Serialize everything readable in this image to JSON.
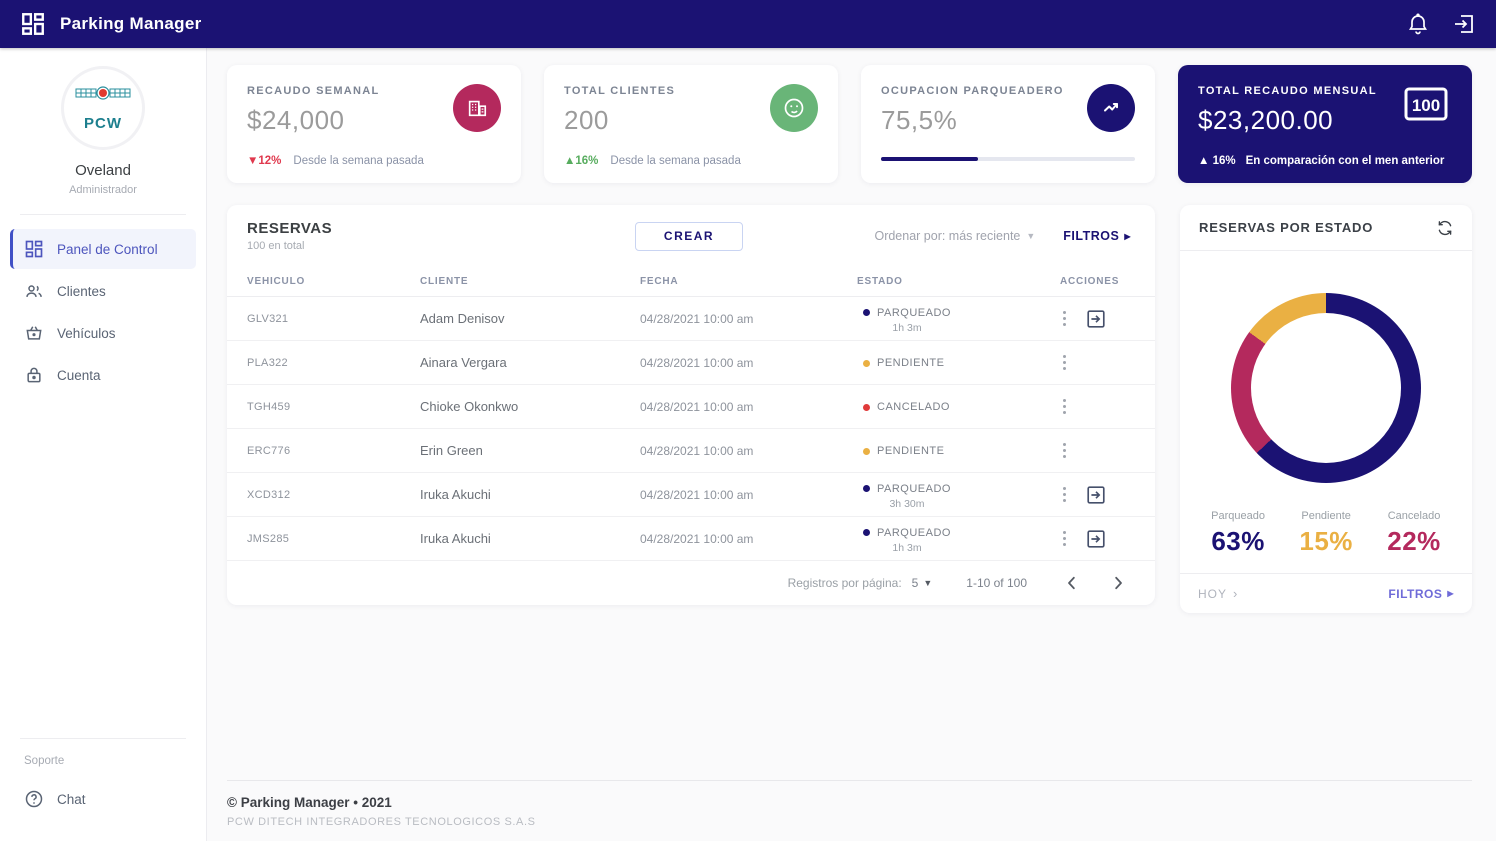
{
  "colors": {
    "primary_navy": "#1b1273",
    "accent_crimson": "#b4295d",
    "accent_amber": "#eab043",
    "accent_green": "#69b578",
    "negative_red": "#e0394e",
    "positive_green": "#57ac5e",
    "filters_purple": "#6f6bd8"
  },
  "topbar": {
    "title": "Parking Manager"
  },
  "sidebar": {
    "logo_text": "PCW",
    "user_name": "Oveland",
    "user_role": "Administrador",
    "items": [
      {
        "label": "Panel de Control",
        "icon": "dashboard-icon",
        "active": true
      },
      {
        "label": "Clientes",
        "icon": "people-icon",
        "active": false
      },
      {
        "label": "Vehículos",
        "icon": "basket-icon",
        "active": false
      },
      {
        "label": "Cuenta",
        "icon": "lock-icon",
        "active": false
      }
    ],
    "support_section_label": "Soporte",
    "chat_item": {
      "label": "Chat",
      "icon": "help-icon"
    }
  },
  "stats": [
    {
      "label": "RECAUDO SEMANAL",
      "value": "$24,000",
      "delta": "12%",
      "delta_dir": "down",
      "note": "Desde la semana pasada",
      "icon": "building-icon",
      "icon_bg": "#b4295d"
    },
    {
      "label": "TOTAL CLIENTES",
      "value": "200",
      "delta": "16%",
      "delta_dir": "up",
      "note": "Desde la semana pasada",
      "icon": "clients-icon",
      "icon_bg": "#69b578"
    },
    {
      "label": "OCUPACION PARQUEADERO",
      "value": "75,5%",
      "icon": "trend-icon",
      "icon_bg": "#1b1273",
      "progress_fill_pct": 38
    },
    {
      "label": "TOTAL RECAUDO MENSUAL",
      "value": "$23,200.00",
      "delta": "16%",
      "delta_dir": "up",
      "note": "En comparación con el men anterior",
      "icon": "banknote-100-icon",
      "dark": true
    }
  ],
  "reservations": {
    "title": "RESERVAS",
    "subtitle": "100 en total",
    "create_label": "CREAR",
    "sort_label": "Ordenar por: más reciente",
    "filters_label": "FILTROS",
    "columns": [
      "VEHICULO",
      "CLIENTE",
      "FECHA",
      "ESTADO",
      "ACCIONES"
    ],
    "rows": [
      {
        "vehicle": "GLV321",
        "client": "Adam Denisov",
        "date": "04/28/2021 10:00 am",
        "status": "PARQUEADO",
        "duration": "1h 3m",
        "status_color": "#1b1273",
        "exit_action": true
      },
      {
        "vehicle": "PLA322",
        "client": "Ainara Vergara",
        "date": "04/28/2021 10:00 am",
        "status": "PENDIENTE",
        "duration": "",
        "status_color": "#eab043",
        "exit_action": false
      },
      {
        "vehicle": "TGH459",
        "client": "Chioke Okonkwo",
        "date": "04/28/2021 10:00 am",
        "status": "CANCELADO",
        "duration": "",
        "status_color": "#e03a3a",
        "exit_action": false
      },
      {
        "vehicle": "ERC776",
        "client": "Erin Green",
        "date": "04/28/2021 10:00 am",
        "status": "PENDIENTE",
        "duration": "",
        "status_color": "#eab043",
        "exit_action": false
      },
      {
        "vehicle": "XCD312",
        "client": "Iruka Akuchi",
        "date": "04/28/2021 10:00 am",
        "status": "PARQUEADO",
        "duration": "3h 30m",
        "status_color": "#1b1273",
        "exit_action": true
      },
      {
        "vehicle": "JMS285",
        "client": "Iruka Akuchi",
        "date": "04/28/2021 10:00 am",
        "status": "PARQUEADO",
        "duration": "1h 3m",
        "status_color": "#1b1273",
        "exit_action": true
      }
    ],
    "pagination": {
      "per_page_label": "Registros por página:",
      "per_page_value": "5",
      "range_label": "1-10 of 100"
    }
  },
  "chart_card": {
    "title": "RESERVAS POR ESTADO",
    "footer_left": "HOY",
    "footer_right": "FILTROS"
  },
  "chart_data": {
    "type": "pie",
    "variant": "donut",
    "title": "RESERVAS POR ESTADO",
    "categories": [
      "Parqueado",
      "Pendiente",
      "Cancelado"
    ],
    "values": [
      63,
      15,
      22
    ],
    "value_labels": [
      "63%",
      "15%",
      "22%"
    ],
    "unit": "%",
    "colors": [
      "#1b1273",
      "#eab043",
      "#b4295d"
    ],
    "segments_clockwise_from_top": [
      {
        "label": "Parqueado",
        "value": 63,
        "color": "#1b1273"
      },
      {
        "label": "Cancelado",
        "value": 22,
        "color": "#b4295d"
      },
      {
        "label": "Pendiente",
        "value": 15,
        "color": "#eab043"
      }
    ],
    "legend_position": "bottom"
  },
  "footer": {
    "line1": "© Parking Manager • 2021",
    "line2": "PCW DITECH INTEGRADORES TECNOLOGICOS S.A.S"
  }
}
